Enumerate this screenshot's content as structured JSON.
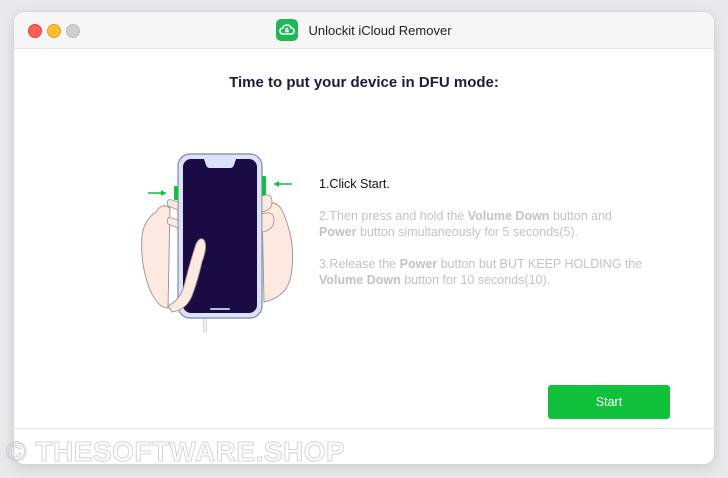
{
  "window": {
    "title": "Unlockit iCloud Remover",
    "logo_icon": "cloud-unlock-icon"
  },
  "main": {
    "heading": "Time to put your device in DFU mode:",
    "steps": [
      {
        "text": "1.Click Start.",
        "state": "active"
      },
      {
        "prefix": "2.Then press and hold the ",
        "bold1": "Volume Down",
        "middle": " button and ",
        "bold2": "Power",
        "suffix": " button simultaneously for 5 seconds(5).",
        "state": "inactive"
      },
      {
        "prefix": "3.Release the ",
        "bold1": "Power",
        "middle": " button but BUT KEEP HOLDING the ",
        "bold2": "Volume Down",
        "suffix": " button for 10 seconds(10).",
        "state": "inactive"
      }
    ],
    "start_button_label": "Start"
  },
  "watermark": "© THESOFTWARE.SHOP",
  "colors": {
    "accent": "#12c13b",
    "phone_screen": "#1a0b45",
    "phone_frame": "#d8def8",
    "heading": "#1b1c3a",
    "muted_text": "#c3c3c7"
  }
}
